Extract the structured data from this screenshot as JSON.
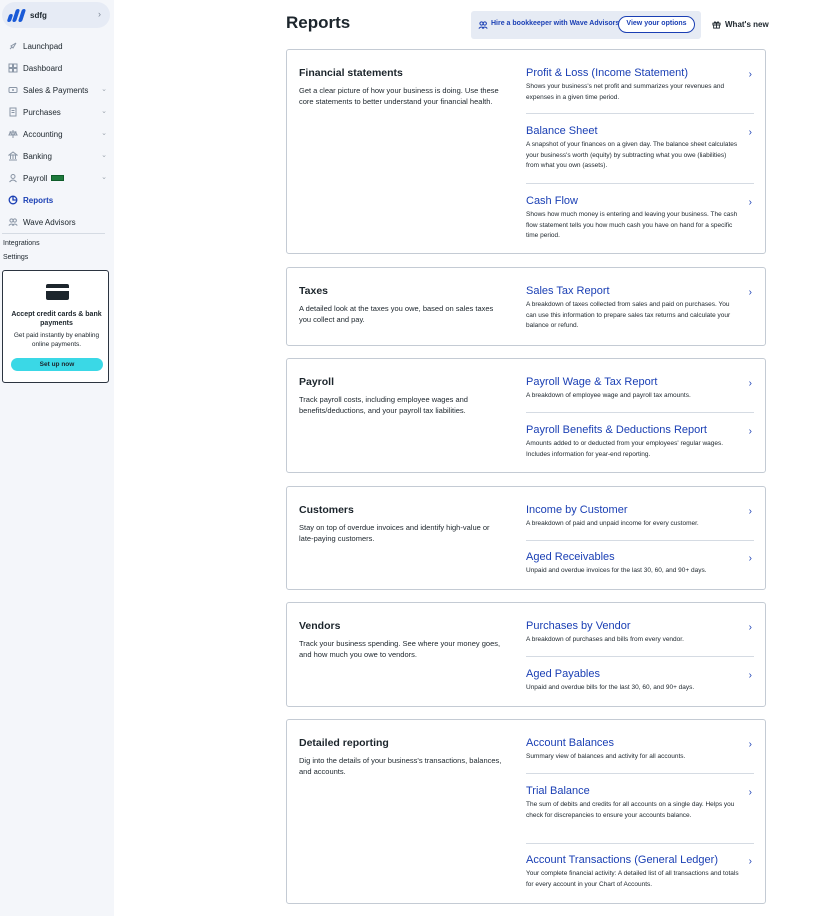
{
  "sidebar": {
    "business_name": "sdfg",
    "items": [
      {
        "label": "Launchpad",
        "icon": "rocket-icon",
        "chevron": false,
        "active": false
      },
      {
        "label": "Dashboard",
        "icon": "dashboard-icon",
        "chevron": false,
        "active": false
      },
      {
        "label": "Sales & Payments",
        "icon": "sales-icon",
        "chevron": true,
        "active": false
      },
      {
        "label": "Purchases",
        "icon": "receipt-icon",
        "chevron": true,
        "active": false
      },
      {
        "label": "Accounting",
        "icon": "scale-icon",
        "chevron": true,
        "active": false
      },
      {
        "label": "Banking",
        "icon": "bank-icon",
        "chevron": true,
        "active": false
      },
      {
        "label": "Payroll",
        "icon": "payroll-icon",
        "chevron": true,
        "active": false
      },
      {
        "label": "Reports",
        "icon": "pie-chart-icon",
        "chevron": false,
        "active": true
      },
      {
        "label": "Wave Advisors",
        "icon": "advisors-icon",
        "chevron": false,
        "active": false
      }
    ],
    "integrations": "Integrations",
    "settings": "Settings",
    "promo": {
      "title": "Accept credit cards & bank payments",
      "text": "Get paid instantly by enabling online payments.",
      "button": "Set up now"
    }
  },
  "header": {
    "title": "Reports",
    "hire_text": "Hire a bookkeeper with Wave Advisors",
    "hire_button": "View your options",
    "whats_new": "What's new"
  },
  "cards": [
    {
      "title": "Financial statements",
      "desc": "Get a clear picture of how your business is doing. Use these core statements to better understand your financial health.",
      "reports": [
        {
          "title": "Profit & Loss (Income Statement)",
          "desc": "Shows your business's net profit and summarizes your revenues and expenses in a given time period."
        },
        {
          "title": "Balance Sheet",
          "desc": "A snapshot of your finances on a given day. The balance sheet calculates your business's worth (equity) by subtracting what you owe (liabilities) from what you own (assets)."
        },
        {
          "title": "Cash Flow",
          "desc": "Shows how much money is entering and leaving your business. The cash flow statement tells you how much cash you have on hand for a specific time period."
        }
      ]
    },
    {
      "title": "Taxes",
      "desc": "A detailed look at the taxes you owe, based on sales taxes you collect and pay.",
      "reports": [
        {
          "title": "Sales Tax Report",
          "desc": "A breakdown of taxes collected from sales and paid on purchases. You can use this information to prepare sales tax returns and calculate your balance or refund."
        }
      ]
    },
    {
      "title": "Payroll",
      "desc": "Track payroll costs, including employee wages and benefits/deductions, and your payroll tax liabilities.",
      "reports": [
        {
          "title": "Payroll Wage & Tax Report",
          "desc": "A breakdown of employee wage and payroll tax amounts."
        },
        {
          "title": "Payroll Benefits & Deductions Report",
          "desc": "Amounts added to or deducted from your employees' regular wages. Includes information for year-end reporting."
        }
      ]
    },
    {
      "title": "Customers",
      "desc": "Stay on top of overdue invoices and identify high-value or late-paying customers.",
      "reports": [
        {
          "title": "Income by Customer",
          "desc": "A breakdown of paid and unpaid income for every customer."
        },
        {
          "title": "Aged Receivables",
          "desc": "Unpaid and overdue invoices for the last 30, 60, and 90+ days."
        }
      ]
    },
    {
      "title": "Vendors",
      "desc": "Track your business spending. See where your money goes, and how much you owe to vendors.",
      "reports": [
        {
          "title": "Purchases by Vendor",
          "desc": "A breakdown of purchases and bills from every vendor."
        },
        {
          "title": "Aged Payables",
          "desc": "Unpaid and overdue bills for the last 30, 60, and 90+ days."
        }
      ]
    },
    {
      "title": "Detailed reporting",
      "desc": "Dig into the details of your business's transactions, balances, and accounts.",
      "reports": [
        {
          "title": "Account Balances",
          "desc": "Summary view of balances and activity for all accounts."
        },
        {
          "title": "Trial Balance",
          "desc": "The sum of debits and credits for all accounts on a single day. Helps you check for discrepancies to ensure your accounts balance."
        },
        {
          "title": "Account Transactions (General Ledger)",
          "desc": "Your complete financial activity: A detailed list of all transactions and totals for every account in your Chart of Accounts."
        }
      ]
    }
  ]
}
